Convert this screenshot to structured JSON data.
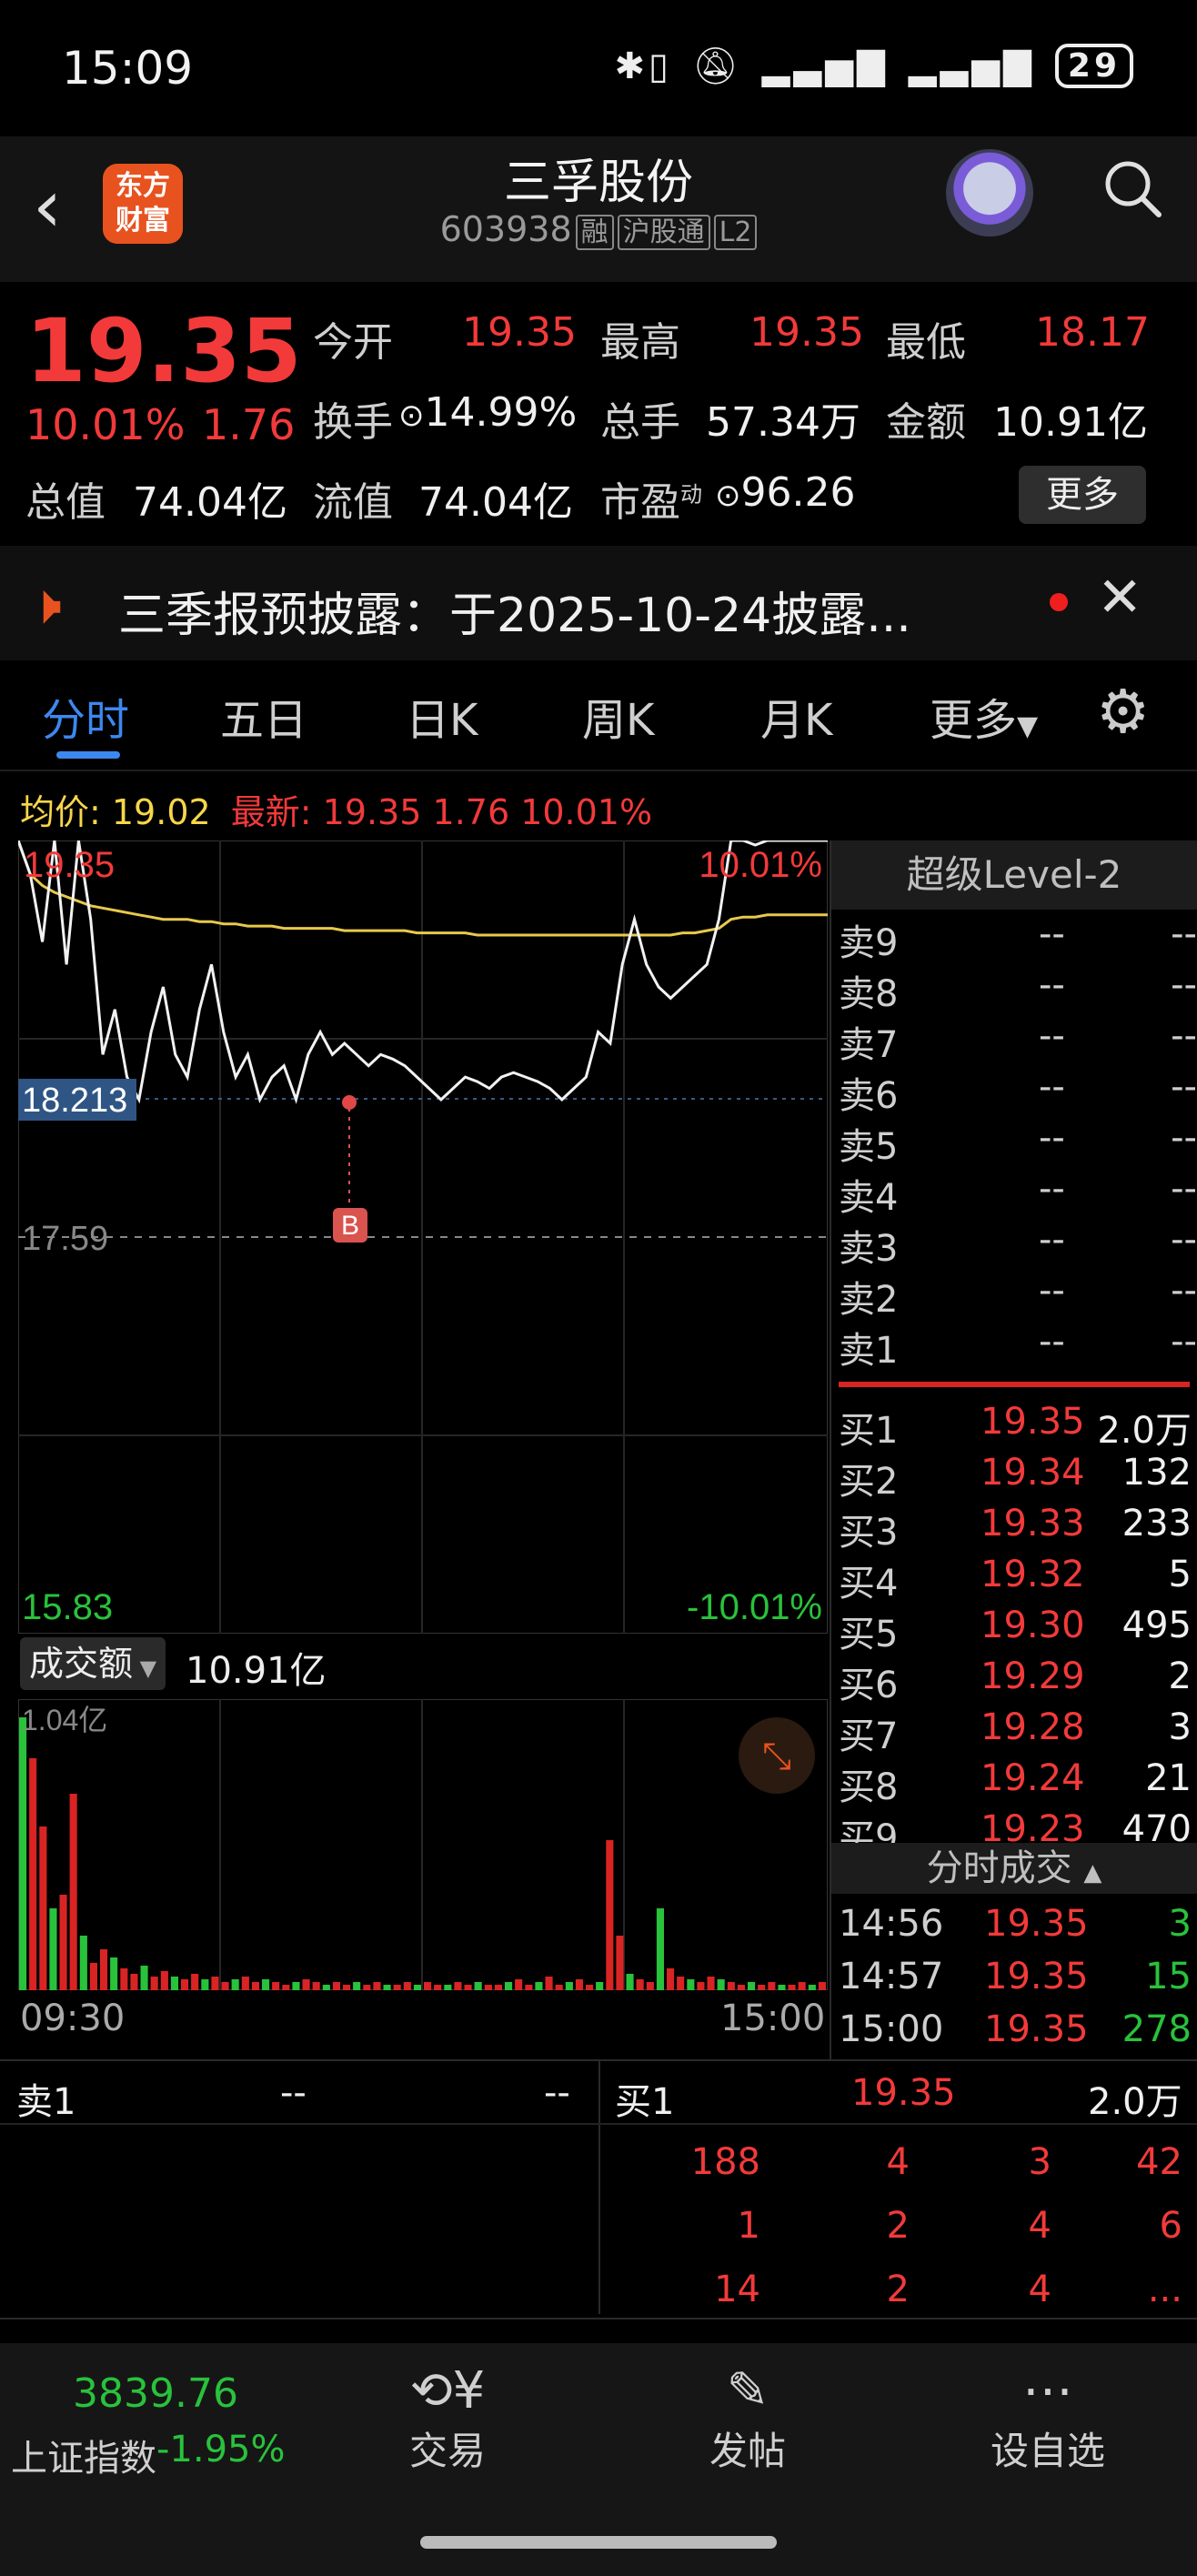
{
  "status_bar": {
    "time": "15:09",
    "battery": "29"
  },
  "header": {
    "logo_line1": "东方",
    "logo_line2": "财富",
    "stock_name": "三孚股份",
    "stock_code": "603938",
    "tags": [
      "融",
      "沪股通",
      "L2"
    ]
  },
  "quote": {
    "price": "19.35",
    "change_pct": "10.01%",
    "change": "1.76",
    "open_label": "今开",
    "open": "19.35",
    "high_label": "最高",
    "high": "19.35",
    "low_label": "最低",
    "low": "18.17",
    "turnover_label": "换手",
    "turnover": "14.99%",
    "volume_label": "总手",
    "volume": "57.34万",
    "amount_label": "金额",
    "amount": "10.91亿",
    "mktcap_label": "总值",
    "mktcap": "74.04亿",
    "float_label": "流值",
    "float_cap": "74.04亿",
    "pe_label": "市盈",
    "pe_sup": "动",
    "pe": "96.26",
    "more_button": "更多"
  },
  "notice": {
    "text": "三季报预披露：于2025-10-24披露..."
  },
  "tabs": [
    "分时",
    "五日",
    "日K",
    "周K",
    "月K",
    "更多"
  ],
  "chart_header": {
    "avg_label": "均价: 19.02",
    "latest_label": "最新: 19.35 1.76 10.01%"
  },
  "chart_labels": {
    "top_price": "19.35",
    "top_pct": "10.01%",
    "crosshair_price": "18.213",
    "prev_close": "17.59",
    "bottom_price": "15.83",
    "bottom_pct": "-10.01%",
    "buy_marker": "B",
    "volume_selector": "成交额",
    "volume_total": "10.91亿",
    "volume_max": "1.04亿",
    "time_start": "09:30",
    "time_end": "15:00"
  },
  "chart_data": {
    "type": "line",
    "ylim": [
      15.83,
      19.35
    ],
    "prev_close": 17.59,
    "x": [
      "09:30",
      "15:00"
    ],
    "series": [],
    "price": [
      19.35,
      19.2,
      18.9,
      19.35,
      18.8,
      19.35,
      19.0,
      18.4,
      18.6,
      18.3,
      18.2,
      18.5,
      18.7,
      18.4,
      18.3,
      18.6,
      18.8,
      18.5,
      18.3,
      18.4,
      18.2,
      18.3,
      18.35,
      18.2,
      18.4,
      18.5,
      18.4,
      18.45,
      18.4,
      18.35,
      18.4,
      18.38,
      18.35,
      18.3,
      18.25,
      18.2,
      18.25,
      18.3,
      18.28,
      18.25,
      18.3,
      18.32,
      18.3,
      18.28,
      18.25,
      18.2,
      18.25,
      18.3,
      18.5,
      18.45,
      18.8,
      19.0,
      18.8,
      18.7,
      18.65,
      18.7,
      18.75,
      18.8,
      19.0,
      19.35,
      19.35,
      19.33,
      19.35,
      19.35,
      19.35,
      19.35,
      19.35,
      19.35
    ],
    "avg": [
      19.35,
      19.2,
      19.15,
      19.12,
      19.1,
      19.08,
      19.06,
      19.05,
      19.04,
      19.03,
      19.02,
      19.01,
      19.0,
      19.0,
      19.0,
      18.99,
      18.99,
      18.98,
      18.98,
      18.97,
      18.97,
      18.97,
      18.96,
      18.96,
      18.96,
      18.96,
      18.96,
      18.95,
      18.95,
      18.95,
      18.95,
      18.95,
      18.95,
      18.94,
      18.94,
      18.94,
      18.94,
      18.94,
      18.93,
      18.93,
      18.93,
      18.93,
      18.93,
      18.93,
      18.93,
      18.93,
      18.93,
      18.93,
      18.93,
      18.93,
      18.93,
      18.93,
      18.93,
      18.93,
      18.93,
      18.94,
      18.94,
      18.95,
      18.96,
      19.0,
      19.01,
      19.01,
      19.02,
      19.02,
      19.02,
      19.02,
      19.02,
      19.02
    ],
    "volume_max": 1.04
  },
  "order_book": {
    "title": "超级Level-2",
    "asks": [
      {
        "label": "卖9",
        "price": "--",
        "vol": "--"
      },
      {
        "label": "卖8",
        "price": "--",
        "vol": "--"
      },
      {
        "label": "卖7",
        "price": "--",
        "vol": "--"
      },
      {
        "label": "卖6",
        "price": "--",
        "vol": "--"
      },
      {
        "label": "卖5",
        "price": "--",
        "vol": "--"
      },
      {
        "label": "卖4",
        "price": "--",
        "vol": "--"
      },
      {
        "label": "卖3",
        "price": "--",
        "vol": "--"
      },
      {
        "label": "卖2",
        "price": "--",
        "vol": "--"
      },
      {
        "label": "卖1",
        "price": "--",
        "vol": "--"
      }
    ],
    "bids": [
      {
        "label": "买1",
        "price": "19.35",
        "vol": "2.0万"
      },
      {
        "label": "买2",
        "price": "19.34",
        "vol": "132"
      },
      {
        "label": "买3",
        "price": "19.33",
        "vol": "233"
      },
      {
        "label": "买4",
        "price": "19.32",
        "vol": "5"
      },
      {
        "label": "买5",
        "price": "19.30",
        "vol": "495"
      },
      {
        "label": "买6",
        "price": "19.29",
        "vol": "2"
      },
      {
        "label": "买7",
        "price": "19.28",
        "vol": "3"
      },
      {
        "label": "买8",
        "price": "19.24",
        "vol": "21"
      },
      {
        "label": "买9",
        "price": "19.23",
        "vol": "470"
      }
    ],
    "ticks_title": "分时成交",
    "ticks": [
      {
        "time": "14:56",
        "price": "19.35",
        "vol": "3",
        "color": "#29c23b"
      },
      {
        "time": "14:57",
        "price": "19.35",
        "vol": "15",
        "color": "#29c23b"
      },
      {
        "time": "15:00",
        "price": "19.35",
        "vol": "278",
        "color": "#29c23b"
      }
    ]
  },
  "book_bottom": {
    "sell_label": "卖1",
    "sell_price": "--",
    "sell_vol": "--",
    "buy_label": "买1",
    "buy_price": "19.35",
    "buy_vol": "2.0万",
    "queue": [
      [
        "188",
        "4",
        "3",
        "42"
      ],
      [
        "1",
        "2",
        "4",
        "6"
      ],
      [
        "14",
        "2",
        "4",
        "..."
      ]
    ]
  },
  "bottom_nav": {
    "index_value": "3839.76",
    "index_name": "上证指数",
    "index_change": "-1.95%",
    "trade": "交易",
    "post": "发帖",
    "watch": "设自选"
  }
}
